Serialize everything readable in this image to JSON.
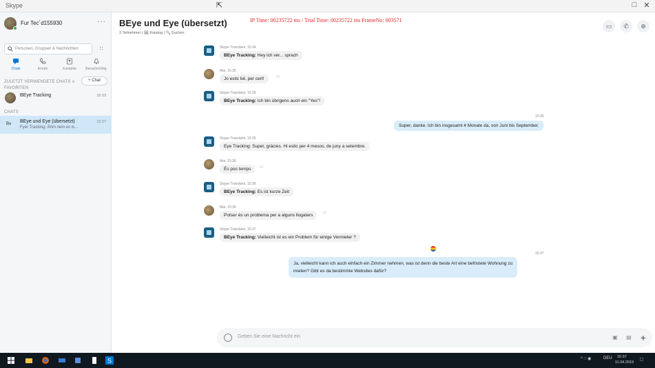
{
  "window": {
    "app_name": "Skype"
  },
  "profile": {
    "name": "Fur Tec´d155930"
  },
  "search": {
    "placeholder": "Personen, Gruppen & Nachrichten"
  },
  "nav": [
    {
      "label": "Chats",
      "icon": "chat-icon",
      "active": true
    },
    {
      "label": "Anrufe",
      "icon": "phone-icon",
      "active": false
    },
    {
      "label": "Kontakte",
      "icon": "contacts-icon",
      "active": false
    },
    {
      "label": "Benachrichtig.",
      "icon": "bell-icon",
      "active": false
    }
  ],
  "sections": {
    "recent": "ZULETZT VERWENDETE CHATS ∨",
    "favorites": "FAVORITEN",
    "chats": "CHATS"
  },
  "new_chat_label": "+ Chat",
  "favorites": [
    {
      "title": "BEye Tracking",
      "time": "15:33"
    }
  ],
  "chats": [
    {
      "initials": "Bu",
      "title": "BEye und Eye (übersetzt)",
      "subtitle": "Fyer Tracking: Ähm nein es is...",
      "time": "15:37"
    }
  ],
  "header": {
    "title": "BEye und Eye (übersetzt)",
    "meta": "3 Teilnehmer | 🖼 Katalog | 🔍 Suchen",
    "overlay_info": "IP Time: 00235722 ms  /  Trial Time: 00235722 ms    FrameNo: 003571"
  },
  "messages": [
    {
      "kind": "bot",
      "sender": "Skype Translator, 15:34",
      "prefix": "BEye Tracking:",
      "text": " Hey ich ver... sprach"
    },
    {
      "kind": "user",
      "sender": "Mar, 15:35",
      "prefix": "",
      "text": "Jo estic bé, per cert!",
      "react": "☺"
    },
    {
      "kind": "bot",
      "sender": "Skype Translator, 15:35",
      "prefix": "BEye Tracking:",
      "text": " Ich bin übrigens auch ein \"Yes\"!"
    },
    {
      "kind": "bot",
      "sender": "Skype Translator, 15:35",
      "prefix": "",
      "text": "Eye Tracking: Super, gràcies. Hi estic per 4 mesos, de juny a setembre."
    },
    {
      "kind": "user",
      "sender": "Mar, 15:36",
      "prefix": "",
      "text": "És poc temps",
      "react": "☺"
    },
    {
      "kind": "bot",
      "sender": "Skype Translator, 15:36",
      "prefix": "BEye Tracking:",
      "text": " Es ist kurze Zeit"
    },
    {
      "kind": "user",
      "sender": "Mar, 15:36",
      "prefix": "",
      "text": "Potser és un problema per a alguns llogaters",
      "react": "☺"
    },
    {
      "kind": "bot",
      "sender": "Skype Translator, 15:37",
      "prefix": "BEye Tracking:",
      "text": " Vielleicht ist es ein Problem für einige Vermieter ?"
    }
  ],
  "own_messages": [
    {
      "time": "15:35",
      "text": "Super, danke. Ich bin insgesamt 4 Monate da, von Juni bis September."
    },
    {
      "time": "15:37",
      "text": "Ja, vielleicht kann ich auch einfach ein Zimmer nehmen, was ist denn die beste Art eine befristete Wohnung zu",
      "text2": "mieten? Gibt es da bestimmte Websites dafür?"
    }
  ],
  "composer": {
    "placeholder": "Geben Sie eine Nachricht ein"
  },
  "tray": {
    "lang": "DEU",
    "time": "15:37",
    "date": "11.04.2019"
  }
}
